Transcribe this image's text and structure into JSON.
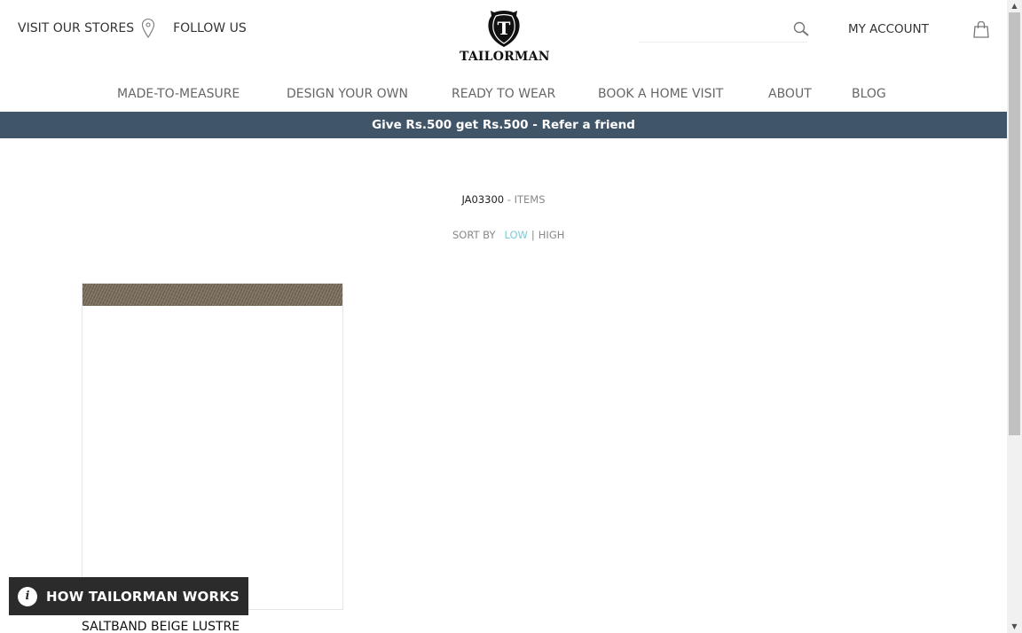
{
  "header": {
    "visit_stores": "VISIT OUR STORES",
    "follow_us": "FOLLOW US",
    "brand": "TAILORMAN",
    "logo_letter": "T",
    "my_account": "MY ACCOUNT"
  },
  "nav": {
    "items": [
      {
        "label": "MADE-TO-MEASURE"
      },
      {
        "label": "DESIGN YOUR OWN"
      },
      {
        "label": "READY TO WEAR"
      },
      {
        "label": "BOOK A HOME VISIT"
      },
      {
        "label": "ABOUT"
      },
      {
        "label": "BLOG"
      }
    ]
  },
  "banner": {
    "text": "Give Rs.500 get Rs.500 - Refer a friend",
    "background": "#415569"
  },
  "listing": {
    "code": "JA03300",
    "items_suffix": " - ITEMS",
    "sort_label": "SORT BY",
    "sort_low": "LOW",
    "sort_separator": "|",
    "sort_high": "HIGH",
    "active_sort_color": "#7ecbd6"
  },
  "products": [
    {
      "name": "SALTBAND BEIGE LUSTRE",
      "swatch_color": "#7a6f5c"
    }
  ],
  "floating": {
    "info_glyph": "i",
    "label": "HOW TAILORMAN WORKS"
  },
  "scrollbar": {
    "up_glyph": "▲",
    "down_glyph": "▼"
  }
}
